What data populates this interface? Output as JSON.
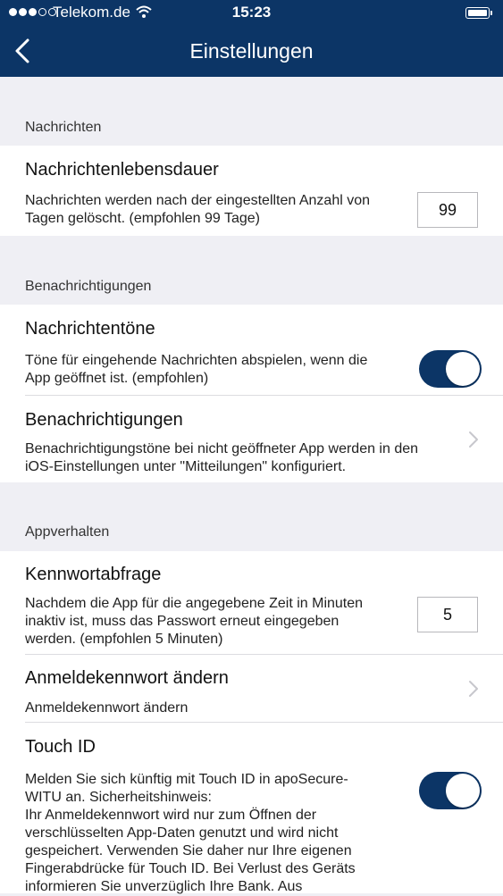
{
  "status_bar": {
    "carrier": "Telekom.de",
    "time": "15:23",
    "signal_bars_filled": 3,
    "signal_bars_total": 5,
    "icons": [
      "signal-icon",
      "wifi-icon",
      "battery-icon"
    ]
  },
  "nav": {
    "title": "Einstellungen",
    "back_icon": "chevron-left-icon"
  },
  "sections": {
    "messages": {
      "header": "Nachrichten",
      "lifetime": {
        "title": "Nachrichtenlebensdauer",
        "line1": "Nachrichten werden nach der eingestellten Anzahl von",
        "line2": "Tagen gelöscht. (empfohlen 99 Tage)",
        "value": "99"
      }
    },
    "notifications": {
      "header": "Benachrichtigungen",
      "tones": {
        "title": "Nachrichtentöne",
        "line1": "Töne für eingehende Nachrichten abspielen, wenn die",
        "line2": "App geöffnet ist. (empfohlen)",
        "enabled": true
      },
      "push": {
        "title": "Benachrichtigungen",
        "line1": "Benachrichtigungstöne bei nicht geöffneter App werden in den",
        "line2": "iOS-Einstellungen unter \"Mitteilungen\" konfiguriert."
      }
    },
    "app_behavior": {
      "header": "Appverhalten",
      "password_prompt": {
        "title": "Kennwortabfrage",
        "line1": "Nachdem die App für die angegebene Zeit in Minuten",
        "line2": "inaktiv ist, muss das Passwort erneut eingegeben",
        "line3": "werden. (empfohlen 5 Minuten)",
        "value": "5"
      },
      "change_password": {
        "title": "Anmeldekennwort ändern",
        "subtitle": "Anmeldekennwort ändern"
      },
      "touch_id": {
        "title": "Touch ID",
        "line1": "Melden Sie sich künftig mit Touch ID in apoSecure-",
        "line2": "WITU an. Sicherheitshinweis:",
        "line3": "Ihr Anmeldekennwort wird nur zum Öffnen der",
        "line4": "verschlüsselten App-Daten genutzt und wird nicht",
        "line5": "gespeichert. Verwenden Sie daher nur Ihre eigenen",
        "line6": "Fingerabdrücke für Touch ID. Bei Verlust des Geräts",
        "line7": "informieren Sie unverzüglich Ihre Bank. Aus",
        "enabled": true
      }
    }
  },
  "colors": {
    "nav_bar": "#0c3566",
    "toggle_on": "#0c3566",
    "grouped_background": "#efeff4",
    "cell_background": "#ffffff"
  }
}
